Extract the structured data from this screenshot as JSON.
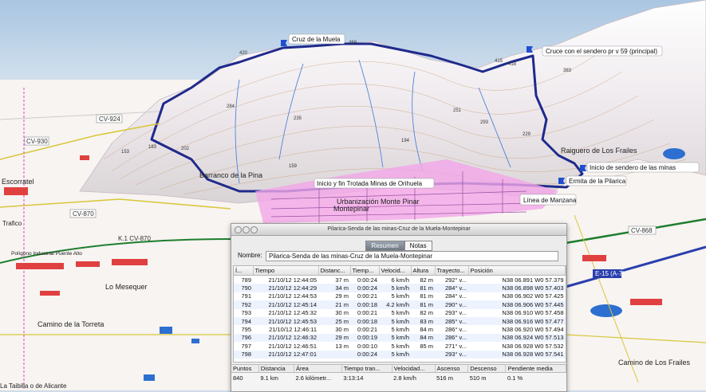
{
  "map": {
    "colors": {
      "sky": "#bfd3e6",
      "terrain": "#f4f1ee",
      "route": "#1f2a8c",
      "urban": "#f2a6e8",
      "water": "#2d6fd0",
      "highway": "#1e7e2e"
    },
    "waypoints": [
      "Cruz de la Muela",
      "Cruce con el sendero pr v 59 (principal)",
      "Inicio y fin Trotada Minas de Orihuela",
      "Inicio de sendero de las minas",
      "Ermita de la Pilarica",
      "Línea de Manzana"
    ],
    "places": [
      "Barranco de la Pina",
      "Raiguero de Los Frailes",
      "Urbanización Monte Pinar",
      "Montepinar",
      "Escorratel",
      "Polígono Industrial Puente Alto",
      "Lo Mesequer",
      "Camino de la Torreta",
      "Camino de Los Frailes",
      "Trafico",
      "La Taibilla o de Alicante"
    ],
    "roads": [
      "CV-924",
      "CV-930",
      "CV-870",
      "K.1 CV-870",
      "CV-868",
      "E-15 (A-7)"
    ],
    "elevations": [
      "469",
      "415",
      "418",
      "420",
      "383",
      "284",
      "235",
      "194",
      "159",
      "183",
      "202",
      "229",
      "251",
      "293",
      "153"
    ]
  },
  "panel": {
    "window_title": "Pilarica-Senda de las minas-Cruz de la Muela-Montepinar",
    "tabs": {
      "resumen": "Resumen",
      "notas": "Notas"
    },
    "nombre_label": "Nombre:",
    "nombre_value": "Pilarica-Senda de las minas-Cruz de la Muela-Montepinar",
    "columns": [
      "Í...",
      "Tiempo",
      "Distanc...",
      "Tiemp...",
      "Velocid...",
      "Altura",
      "Trayecto...",
      "Posición"
    ],
    "rows": [
      [
        "789",
        "21/10/12 12:44:05",
        "37 m",
        "0:00:24",
        "6 km/h",
        "82 m",
        "292° v...",
        "N38 06.891 W0 57.379"
      ],
      [
        "790",
        "21/10/12 12:44:29",
        "34 m",
        "0:00:24",
        "5 km/h",
        "81 m",
        "284° v...",
        "N38 06.898 W0 57.403"
      ],
      [
        "791",
        "21/10/12 12:44:53",
        "29 m",
        "0:00:21",
        "5 km/h",
        "81 m",
        "284° v...",
        "N38 06.902 W0 57.425"
      ],
      [
        "792",
        "21/10/12 12:45:14",
        "21 m",
        "0:00:18",
        "4.2 km/h",
        "81 m",
        "290° v...",
        "N38 06.906 W0 57.445"
      ],
      [
        "793",
        "21/10/12 12:45:32",
        "30 m",
        "0:00:21",
        "5 km/h",
        "82 m",
        "293° v...",
        "N38 06.910 W0 57.458"
      ],
      [
        "794",
        "21/10/12 12:45:53",
        "25 m",
        "0:00:18",
        "5 km/h",
        "83 m",
        "285° v...",
        "N38 06.916 W0 57.477"
      ],
      [
        "795",
        "21/10/12 12:46:11",
        "30 m",
        "0:00:21",
        "5 km/h",
        "84 m",
        "286° v...",
        "N38 06.920 W0 57.494"
      ],
      [
        "796",
        "21/10/12 12:46:32",
        "29 m",
        "0:00:19",
        "5 km/h",
        "84 m",
        "286° v...",
        "N38 06.924 W0 57.513"
      ],
      [
        "797",
        "21/10/12 12:46:51",
        "13 m",
        "0:00:10",
        "5 km/h",
        "85 m",
        "271° v...",
        "N38 06.928 W0 57.532"
      ],
      [
        "798",
        "21/10/12 12:47:01",
        "",
        "0:00:24",
        "5 km/h",
        "",
        "293° v...",
        "N38 06.928 W0 57.541"
      ]
    ],
    "summary_headers": [
      "Puntos",
      "Distancia",
      "Área",
      "Tiempo tran...",
      "Velocidad...",
      "Ascenso",
      "Descenso",
      "Pendiente media"
    ],
    "summary_values": [
      "840",
      "9.1 km",
      "2.6 kilómetr...",
      "3:13:14",
      "2.8 km/h",
      "516 m",
      "510 m",
      "0.1 %"
    ]
  }
}
